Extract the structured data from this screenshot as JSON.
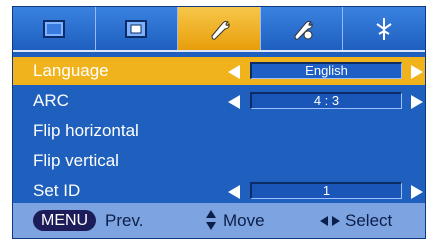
{
  "tabs": [
    {
      "icon": "picture-icon",
      "active": false
    },
    {
      "icon": "screen-icon",
      "active": false
    },
    {
      "icon": "setup-tool-icon",
      "active": true
    },
    {
      "icon": "special-tool-icon",
      "active": false
    },
    {
      "icon": "input-source-icon",
      "active": false
    }
  ],
  "menu": {
    "items": [
      {
        "label": "Language",
        "value": "English",
        "has_value": true,
        "active": true
      },
      {
        "label": "ARC",
        "value": "4 : 3",
        "has_value": true,
        "active": false
      },
      {
        "label": "Flip horizontal",
        "value": "",
        "has_value": false,
        "active": false
      },
      {
        "label": "Flip vertical",
        "value": "",
        "has_value": false,
        "active": false
      },
      {
        "label": "Set ID",
        "value": "1",
        "has_value": true,
        "active": false
      }
    ]
  },
  "help": {
    "menu_key": "MENU",
    "prev_label": "Prev.",
    "move_label": "Move",
    "select_label": "Select"
  },
  "colors": {
    "panel": "#1f5fbd",
    "highlight": "#f0b31c",
    "help_bar": "#7da3e0"
  }
}
